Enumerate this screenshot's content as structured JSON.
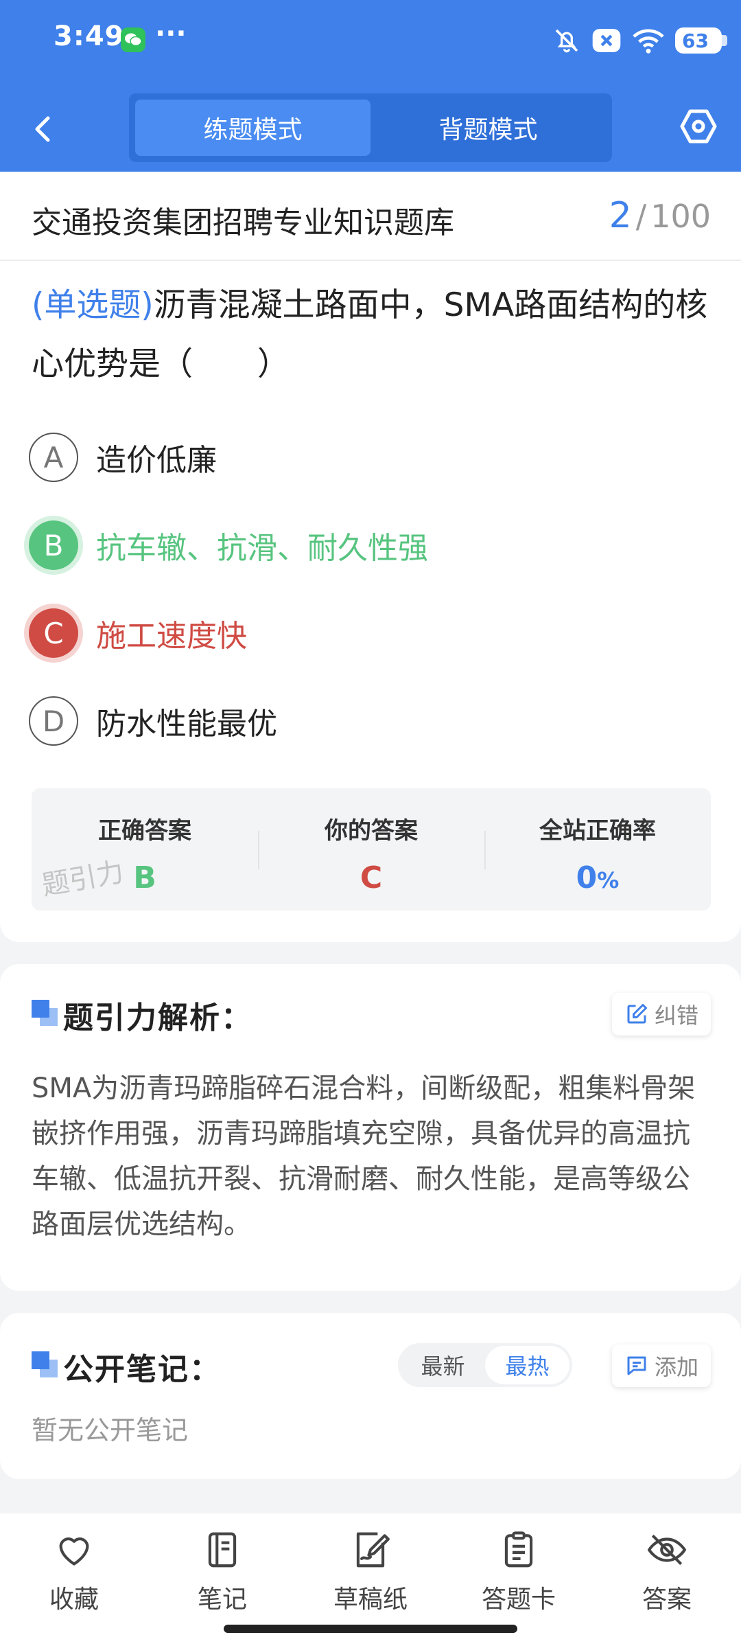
{
  "status_bar": {
    "time": "3:49",
    "dots": "···",
    "battery": "63",
    "icons": [
      "wechat-icon",
      "bell-off-icon",
      "x-badge-icon",
      "wifi-icon",
      "battery-icon"
    ]
  },
  "nav": {
    "back_icon": "chevron-left-icon",
    "tabs": [
      {
        "label": "练题模式",
        "active": true
      },
      {
        "label": "背题模式",
        "active": false
      }
    ],
    "settings_icon": "hexagon-settings-icon"
  },
  "header": {
    "bank_title": "交通投资集团招聘专业知识题库",
    "current": "2",
    "slash": "/",
    "total": "100"
  },
  "question": {
    "type": "(单选题)",
    "text": "沥青混凝土路面中，SMA路面结构的核心优势是（　　）",
    "options": [
      {
        "letter": "A",
        "text": "造价低廉",
        "state": "normal"
      },
      {
        "letter": "B",
        "text": "抗车辙、抗滑、耐久性强",
        "state": "correct"
      },
      {
        "letter": "C",
        "text": "施工速度快",
        "state": "wrong"
      },
      {
        "letter": "D",
        "text": "防水性能最优",
        "state": "normal"
      }
    ]
  },
  "answer_summary": {
    "correct_label": "正确答案",
    "correct_value": "B",
    "yours_label": "你的答案",
    "yours_value": "C",
    "rate_label": "全站正确率",
    "rate_value": "0",
    "rate_unit": "%",
    "watermark": "题引力"
  },
  "analysis": {
    "title": "题引力解析：",
    "correction_label": "纠错",
    "body": "SMA为沥青玛蹄脂碎石混合料，间断级配，粗集料骨架嵌挤作用强，沥青玛蹄脂填充空隙，具备优异的高温抗车辙、低温抗开裂、抗滑耐磨、耐久性能，是高等级公路面层优选结构。"
  },
  "notes": {
    "title": "公开笔记：",
    "sort_tabs": [
      {
        "label": "最新",
        "active": false
      },
      {
        "label": "最热",
        "active": true
      }
    ],
    "add_label": "添加",
    "empty_text": "暂无公开笔记"
  },
  "bottom_bar": [
    {
      "label": "收藏",
      "icon": "heart-icon"
    },
    {
      "label": "笔记",
      "icon": "notebook-icon"
    },
    {
      "label": "草稿纸",
      "icon": "draft-pen-icon"
    },
    {
      "label": "答题卡",
      "icon": "clipboard-icon"
    },
    {
      "label": "答案",
      "icon": "eye-off-icon"
    }
  ],
  "colors": {
    "primary": "#3f80ea",
    "correct": "#57c47f",
    "wrong": "#cf4b43"
  }
}
